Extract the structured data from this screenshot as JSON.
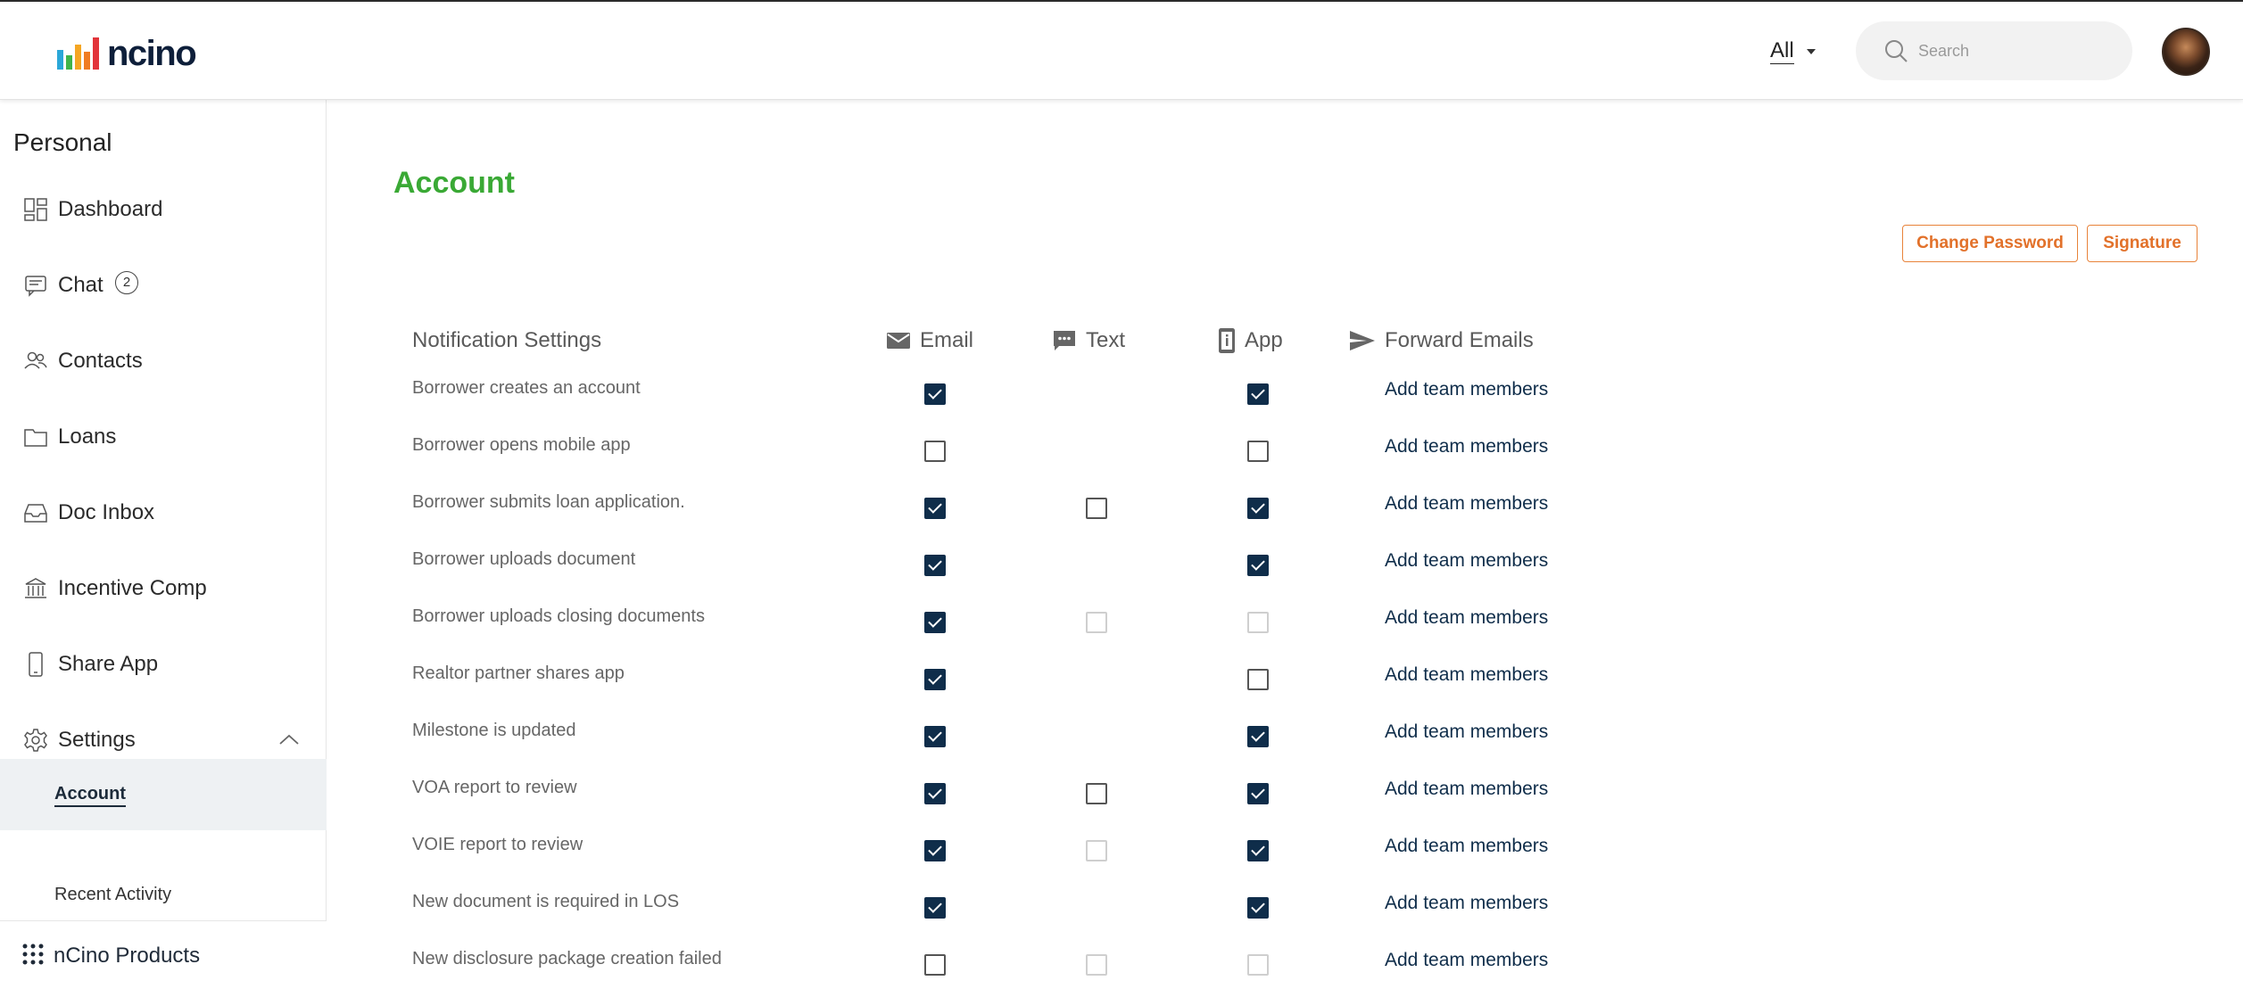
{
  "header": {
    "brand": "ncino",
    "scope_label": "All",
    "search_placeholder": "Search"
  },
  "sidebar": {
    "section_title": "Personal",
    "items": [
      {
        "label": "Dashboard",
        "icon": "dashboard-icon"
      },
      {
        "label": "Chat",
        "icon": "chat-icon",
        "badge": "2"
      },
      {
        "label": "Contacts",
        "icon": "contacts-icon"
      },
      {
        "label": "Loans",
        "icon": "folder-icon"
      },
      {
        "label": "Doc Inbox",
        "icon": "inbox-icon"
      },
      {
        "label": "Incentive Comp",
        "icon": "bank-icon"
      },
      {
        "label": "Share App",
        "icon": "phone-icon"
      },
      {
        "label": "Settings",
        "icon": "gear-icon",
        "expanded": true
      }
    ],
    "settings_sub": {
      "active": "Account",
      "other": "Recent Activity"
    },
    "products_label": "nCino Products"
  },
  "main": {
    "title": "Account",
    "buttons": {
      "change_password": "Change Password",
      "signature": "Signature"
    },
    "table": {
      "headers": {
        "label": "Notification Settings",
        "email": "Email",
        "text": "Text",
        "app": "App",
        "forward": "Forward Emails"
      },
      "add_label": "Add team members",
      "rows": [
        {
          "name": "Borrower creates an account",
          "email": "checked",
          "text": "none",
          "app": "checked"
        },
        {
          "name": "Borrower opens mobile app",
          "email": "unchecked",
          "text": "none",
          "app": "unchecked"
        },
        {
          "name": "Borrower submits loan application.",
          "email": "checked",
          "text": "unchecked",
          "app": "checked"
        },
        {
          "name": "Borrower uploads document",
          "email": "checked",
          "text": "none",
          "app": "checked"
        },
        {
          "name": "Borrower uploads closing documents",
          "email": "checked",
          "text": "disabled",
          "app": "disabled"
        },
        {
          "name": "Realtor partner shares app",
          "email": "checked",
          "text": "none",
          "app": "unchecked"
        },
        {
          "name": "Milestone is updated",
          "email": "checked",
          "text": "none",
          "app": "checked"
        },
        {
          "name": "VOA report to review",
          "email": "checked",
          "text": "unchecked",
          "app": "checked"
        },
        {
          "name": "VOIE report to review",
          "email": "checked",
          "text": "disabled",
          "app": "checked"
        },
        {
          "name": "New document is required in LOS",
          "email": "checked",
          "text": "none",
          "app": "checked"
        },
        {
          "name": "New disclosure package creation failed",
          "email": "unchecked",
          "text": "disabled",
          "app": "disabled"
        }
      ]
    }
  },
  "colors": {
    "accent_green": "#3aa935",
    "button_orange": "#e2712a",
    "checkbox_navy": "#0f2d4a"
  }
}
